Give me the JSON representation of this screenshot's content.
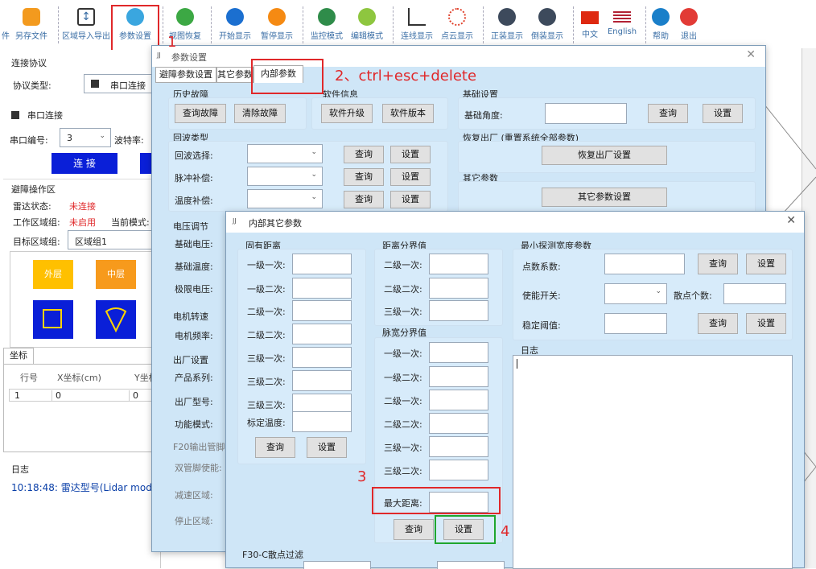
{
  "toolbar": {
    "items": [
      {
        "id": "file",
        "label": "件",
        "icon": "file-icon"
      },
      {
        "id": "saveas",
        "label": "另存文件",
        "icon": "save-as-icon"
      },
      {
        "id": "import",
        "label": "区域导入导出",
        "icon": "import-export-icon"
      },
      {
        "id": "params",
        "label": "参数设置",
        "icon": "settings-icon"
      },
      {
        "id": "viewreset",
        "label": "视图恢复",
        "icon": "reset-view-icon"
      },
      {
        "id": "start",
        "label": "开始显示",
        "icon": "play-icon"
      },
      {
        "id": "pause",
        "label": "暂停显示",
        "icon": "pause-icon"
      },
      {
        "id": "monitor",
        "label": "监控模式",
        "icon": "monitor-icon"
      },
      {
        "id": "edit",
        "label": "编辑模式",
        "icon": "edit-icon"
      },
      {
        "id": "line",
        "label": "连线显示",
        "icon": "line-chart-icon"
      },
      {
        "id": "cloud",
        "label": "点云显示",
        "icon": "point-cloud-icon"
      },
      {
        "id": "normal",
        "label": "正装显示",
        "icon": "normal-mount-icon"
      },
      {
        "id": "invert",
        "label": "倒装显示",
        "icon": "inverted-mount-icon"
      },
      {
        "id": "zh",
        "label": "中文",
        "icon": "china-flag-icon"
      },
      {
        "id": "en",
        "label": "English",
        "icon": "us-flag-icon"
      },
      {
        "id": "help",
        "label": "帮助",
        "icon": "help-icon"
      },
      {
        "id": "exit",
        "label": "退出",
        "icon": "power-icon"
      }
    ]
  },
  "left": {
    "protocol_title": "连接协议",
    "protocol_label": "协议类型:",
    "protocol_value": "串口连接",
    "serial_title": "串口连接",
    "port_label": "串口编号:",
    "port_value": "3",
    "baud_label": "波特率:",
    "connect_btn": "连 接",
    "avoid_title": "避障操作区",
    "radar_status_label": "雷达状态:",
    "radar_status_value": "未连接",
    "work_group_label": "工作区域组:",
    "work_group_value": "未启用",
    "mode_label": "当前模式:",
    "target_group_label": "目标区域组:",
    "target_group_value": "区域组1",
    "outer_label": "外层",
    "middle_label": "中层",
    "coord_tab": "坐标",
    "col_row": "行号",
    "col_x": "X坐标(cm)",
    "col_y": "Y坐标",
    "row1": [
      "1",
      "0",
      "0"
    ],
    "log_title": "日志",
    "log_text": "10:18:48:  雷达型号(Lidar mode"
  },
  "param_win": {
    "title": "参数设置",
    "tabs": [
      "避障参数设置",
      "其它参数",
      "内部参数"
    ],
    "history_title": "历史故障",
    "query_fault": "查询故障",
    "clear_fault": "清除故障",
    "software_title": "软件信息",
    "sw_upgrade": "软件升级",
    "sw_version": "软件版本",
    "echo_title": "回波类型",
    "echo_select": "回波选择:",
    "pulse_comp": "脉冲补偿:",
    "temp_comp": "温度补偿:",
    "query": "查询",
    "set": "设置",
    "voltage_title": "电压调节",
    "base_voltage": "基础电压:",
    "base_temp": "基础温度:",
    "limit_voltage": "极限电压:",
    "motor_title": "电机转速",
    "motor_freq": "电机频率:",
    "factory_title": "出厂设置",
    "product_series": "产品系列:",
    "factory_model": "出厂型号:",
    "func_mode": "功能模式:",
    "f20_title": "F20输出管脚",
    "dual_pin": "双管脚使能:",
    "slow_zone": "减速区域:",
    "stop_zone": "停止区域:",
    "basic_title": "基础设置",
    "basic_angle": "基础角度:",
    "restore_title": "恢复出厂 (重置系统全部参数)",
    "restore_btn": "恢复出厂设置",
    "other_title": "其它参数",
    "other_btn": "其它参数设置"
  },
  "inner_win": {
    "title": "内部其它参数",
    "fixed_title": "固有距离",
    "fixed_rows": [
      "一级一次:",
      "一级二次:",
      "二级一次:",
      "二级二次:",
      "三级一次:",
      "三级二次:",
      "三级三次:",
      "标定温度:"
    ],
    "dist_title": "距离分界值",
    "dist_rows": [
      "二级一次:",
      "二级二次:",
      "三级一次:"
    ],
    "pulse_title": "脉宽分界值",
    "pulse_rows": [
      "一级一次:",
      "一级二次:",
      "二级一次:",
      "二级二次:",
      "三级一次:",
      "三级二次:"
    ],
    "max_dist": "最大距离:",
    "query": "查询",
    "set": "设置",
    "min_title": "最小探测宽度参数",
    "point_coef": "点数系数:",
    "enable_switch": "使能开关:",
    "scatter_count": "散点个数:",
    "stable_thresh": "稳定阈值:",
    "log_title": "日志",
    "f30_title": "F30-C散点过滤"
  },
  "annotations": {
    "n1": "1",
    "n2": "2、ctrl+esc+delete",
    "n3": "3",
    "n4": "4"
  },
  "colors": {
    "accent_blue": "#0a1fd8",
    "annotation_red": "#e0282a",
    "annotation_green": "#1fa62e",
    "panel_bg": "#cfe6f7",
    "status_red": "#e0282a"
  }
}
